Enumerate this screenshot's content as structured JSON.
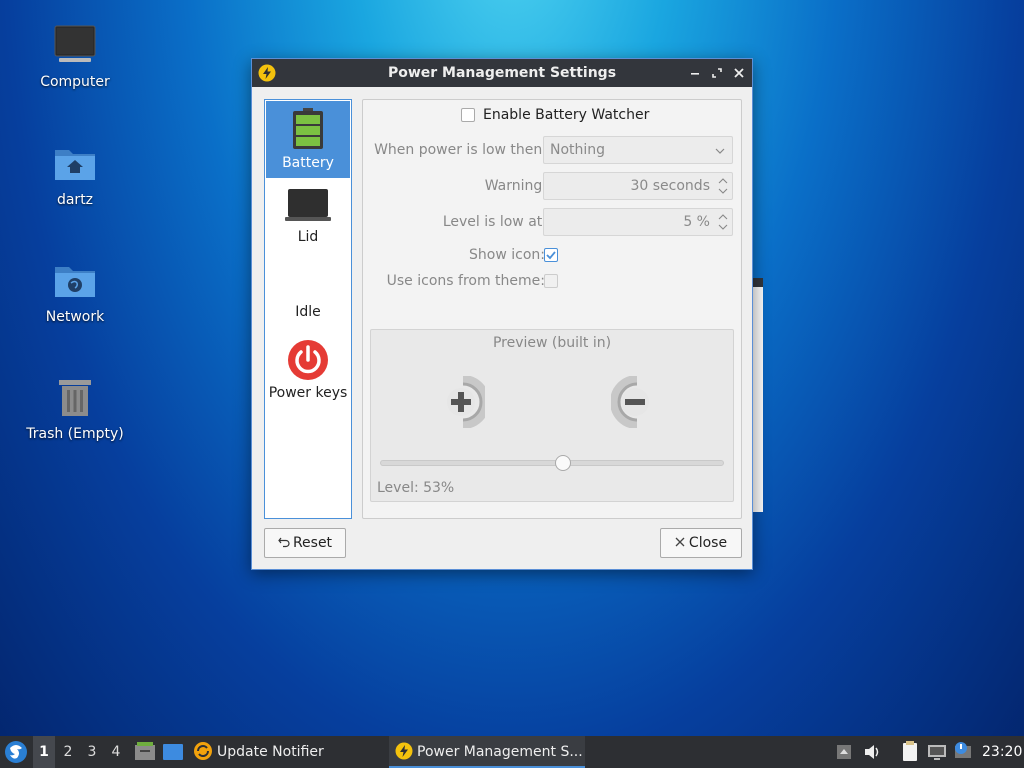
{
  "desktop": {
    "icons": [
      {
        "label": "Computer",
        "icon": "computer-icon"
      },
      {
        "label": "dartz",
        "icon": "home-folder-icon"
      },
      {
        "label": "Network",
        "icon": "network-folder-icon"
      },
      {
        "label": "Trash (Empty)",
        "icon": "trash-icon"
      }
    ]
  },
  "window": {
    "title": "Power Management Settings",
    "controls": {
      "minimize": "minimize-icon",
      "maximize": "maximize-icon",
      "close": "close-icon"
    },
    "sidebar": {
      "items": [
        {
          "label": "Battery",
          "icon": "battery-icon",
          "selected": true
        },
        {
          "label": "Lid",
          "icon": "laptop-lid-icon",
          "selected": false
        },
        {
          "label": "Idle",
          "icon": "",
          "selected": false
        },
        {
          "label": "Power keys",
          "icon": "power-button-icon",
          "selected": false
        }
      ]
    },
    "battery": {
      "enable_label": "Enable Battery Watcher",
      "enable_checked": false,
      "when_low_label": "When power is low then:",
      "when_low_value": "Nothing",
      "warning_label": "Warning:",
      "warning_value": "30 seconds",
      "level_low_label": "Level is low at:",
      "level_low_value": "5 %",
      "show_icon_label": "Show icon:",
      "show_icon_checked": true,
      "theme_icons_label": "Use icons from theme:",
      "theme_icons_checked": false,
      "preview": {
        "title": "Preview (built in)",
        "level_text": "Level: 53%",
        "level_percent": 53
      }
    },
    "buttons": {
      "reset": "Reset",
      "close": "Close"
    },
    "colors": {
      "accent": "#4a90d9",
      "titlebar": "#33363c",
      "power_red": "#e53b35",
      "battery_green": "#7bc142"
    }
  },
  "taskbar": {
    "workspaces": [
      "1",
      "2",
      "3",
      "4"
    ],
    "active_workspace": "1",
    "tasks": [
      {
        "label": "Update Notifier",
        "icon": "update-notifier-icon",
        "active": false
      },
      {
        "label": "Power Management S...",
        "icon": "power-manager-icon",
        "active": true
      }
    ],
    "clock": "23:20"
  }
}
